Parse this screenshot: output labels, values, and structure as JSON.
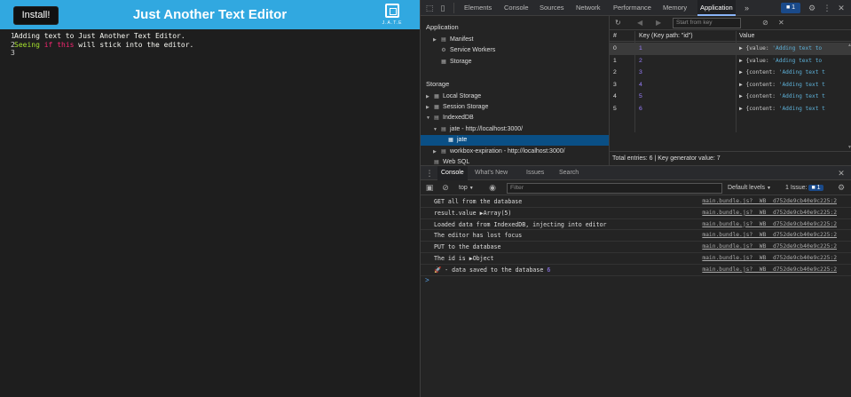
{
  "app": {
    "install_label": "Install!",
    "title": "Just Another Text Editor",
    "logo_text": "J.A.T.E",
    "editor": {
      "line_numbers": [
        "1",
        "2",
        "3"
      ],
      "line1": "Adding text to Just Another Text Editor.",
      "line2_a": "Seeing",
      "line2_b": "if",
      "line2_c": "this",
      "line2_d": "will stick into the editor."
    }
  },
  "devtools": {
    "tabs": [
      "Elements",
      "Console",
      "Sources",
      "Network",
      "Performance",
      "Memory",
      "Application"
    ],
    "active_tab": "Application",
    "more_tabs": "»",
    "issues_count": "1",
    "sidebar": {
      "application_heading": "Application",
      "application_items": [
        "Manifest",
        "Service Workers",
        "Storage"
      ],
      "storage_heading": "Storage",
      "storage_items": [
        "Local Storage",
        "Session Storage",
        "IndexedDB"
      ],
      "db_name": "jate - http://localhost:3000/",
      "store_name": "jate",
      "db_name_2": "workbox-expiration - http://localhost:3000/",
      "web_sql": "Web SQL"
    },
    "db_table": {
      "start_key_placeholder": "Start from key",
      "headers": {
        "num": "#",
        "key": "Key (Key path: \"id\")",
        "value": "Value"
      },
      "rows": [
        {
          "num": "0",
          "key": "1",
          "field": "value",
          "text": "'Adding text to"
        },
        {
          "num": "1",
          "key": "2",
          "field": "value",
          "text": "'Adding text to"
        },
        {
          "num": "2",
          "key": "3",
          "field": "content",
          "text": "'Adding text t"
        },
        {
          "num": "3",
          "key": "4",
          "field": "content",
          "text": "'Adding text t"
        },
        {
          "num": "4",
          "key": "5",
          "field": "content",
          "text": "'Adding text t"
        },
        {
          "num": "5",
          "key": "6",
          "field": "content",
          "text": "'Adding text t"
        }
      ],
      "footer": "Total entries: 6  |  Key generator value: 7"
    },
    "drawer": {
      "tabs": [
        "Console",
        "What's New",
        "Issues",
        "Search"
      ],
      "active_tab": "Console",
      "context": "top",
      "filter_placeholder": "Filter",
      "levels": "Default levels",
      "issues_label": "1 Issue:",
      "issues_count": "1"
    },
    "console": {
      "source": "main.bundle.js?__WB__d752de9cb40e9c225:2",
      "messages": [
        {
          "text": "GET all from the database"
        },
        {
          "text": "result.value",
          "suffix": "Array(5)"
        },
        {
          "text": "Loaded data from IndexedDB, injecting into editor"
        },
        {
          "text": "The editor has lost focus"
        },
        {
          "text": "PUT to the database"
        },
        {
          "text": "The id is",
          "suffix": "Object"
        },
        {
          "text": "🚀 - data saved to the database",
          "number": "6"
        }
      ],
      "prompt": ">"
    }
  }
}
